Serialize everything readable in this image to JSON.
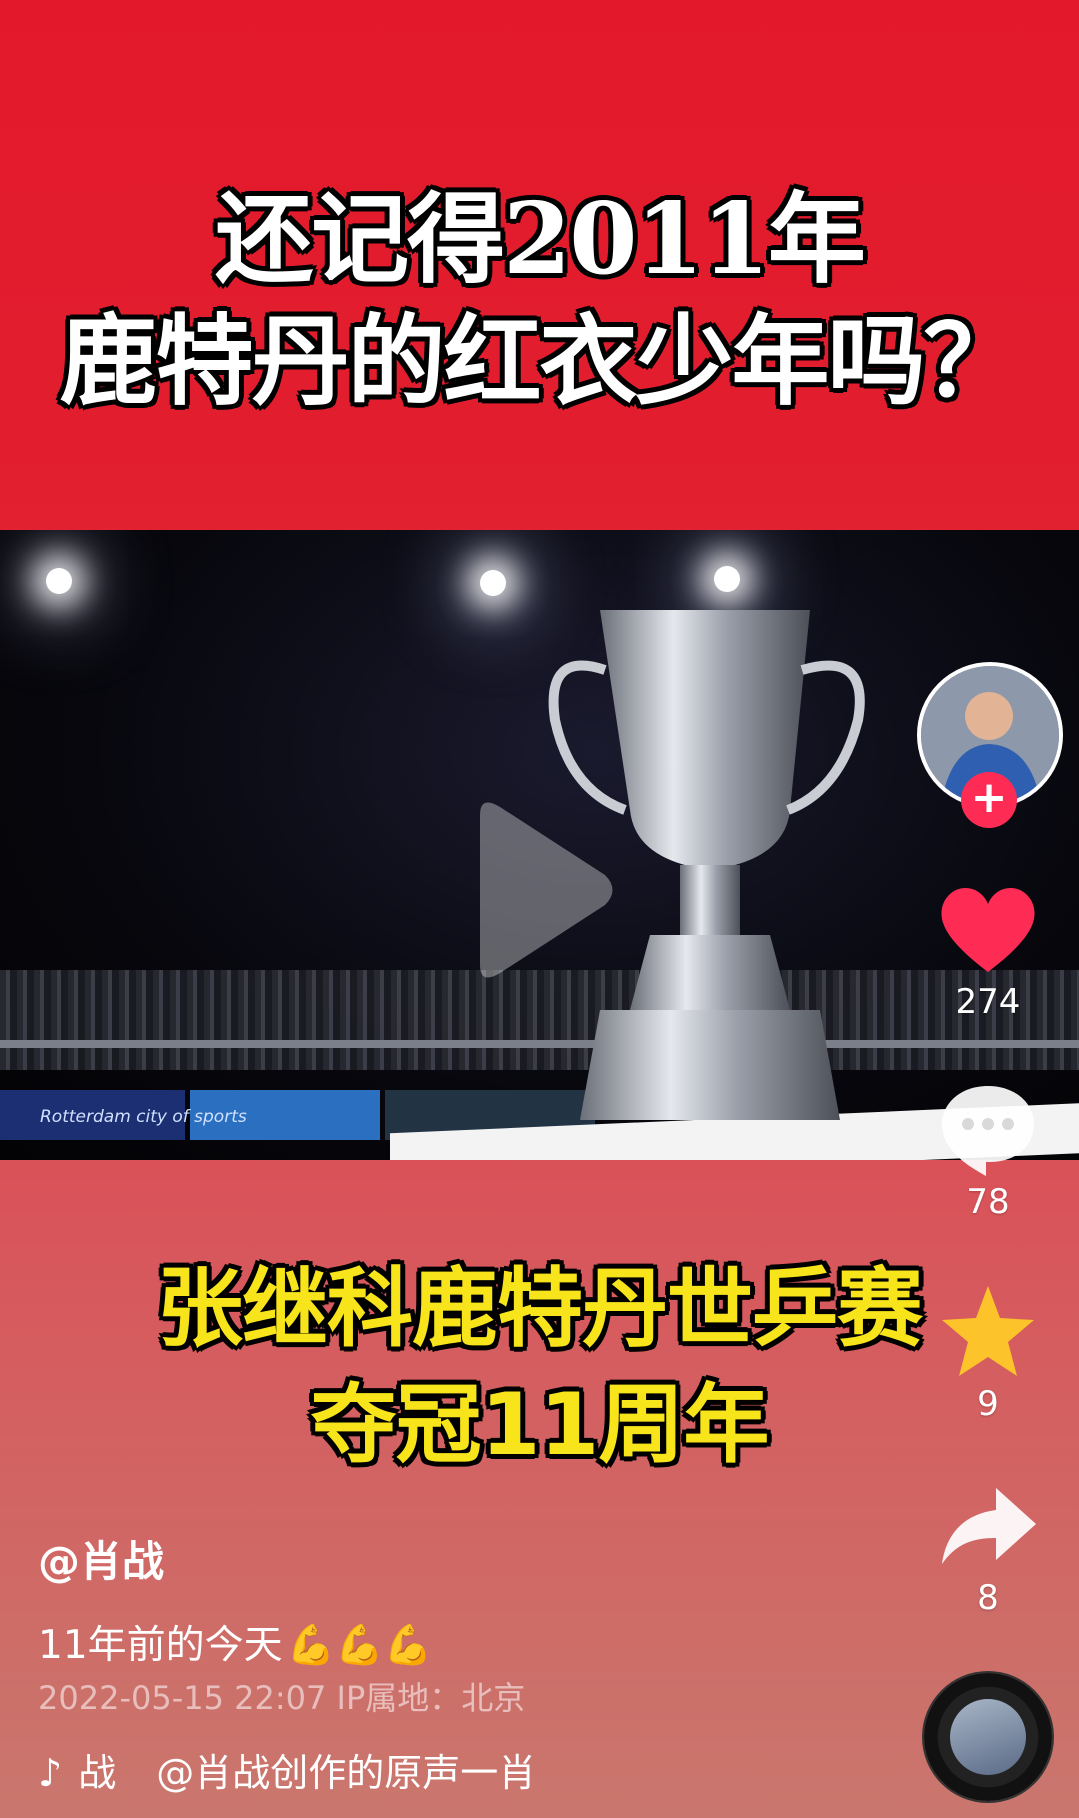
{
  "banner": {
    "line1": "还记得2011年",
    "line2": "鹿特丹的红衣少年吗？"
  },
  "video": {
    "board_text": "Rotterdam city of sports",
    "play_icon": "play-icon"
  },
  "overlay": {
    "line1": "张继科鹿特丹世乒赛",
    "line2": "夺冠11周年"
  },
  "actions": {
    "follow_label": "+",
    "likes": "274",
    "comments": "78",
    "favorites": "9",
    "shares": "8"
  },
  "post": {
    "author": "@肖战",
    "caption": "11年前的今天",
    "caption_emoji": "💪💪💪",
    "meta": "2022-05-15 22:07  IP属地：北京",
    "music_prefix": "战",
    "music_title": "@肖战创作的原声一肖"
  },
  "colors": {
    "like": "#fe2c55",
    "favorite": "#fdc32a",
    "subtitle": "#f7e41a"
  }
}
